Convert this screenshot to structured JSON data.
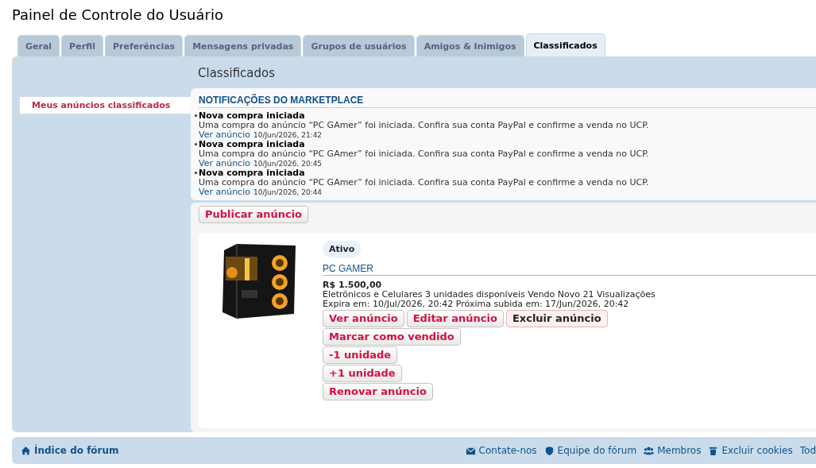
{
  "page_title": "Painel de Controle do Usuário",
  "tabs": [
    {
      "label": "Geral",
      "selected": false
    },
    {
      "label": "Perfil",
      "selected": false
    },
    {
      "label": "Preferências",
      "selected": false
    },
    {
      "label": "Mensagens privadas",
      "selected": false
    },
    {
      "label": "Grupos de usuários",
      "selected": false
    },
    {
      "label": "Amigos & Inimigos",
      "selected": false
    },
    {
      "label": "Classificados",
      "selected": true
    }
  ],
  "sidebar": {
    "items": [
      {
        "label": "Meus anúncios classificados",
        "selected": true
      }
    ]
  },
  "heading": "Classificados",
  "notifications": {
    "title": "NOTIFICAÇÕES DO MARKETPLACE",
    "items": [
      {
        "title": "Nova compra iniciada",
        "text": "Uma compra do anúncio “PC GAmer” foi iniciada. Confira sua conta PayPal e confirme a venda no UCP.",
        "link": "Ver anúncio",
        "time": "10/Jun/2026, 21:42"
      },
      {
        "title": "Nova compra iniciada",
        "text": "Uma compra do anúncio “PC GAmer” foi iniciada. Confira sua conta PayPal e confirme a venda no UCP.",
        "link": "Ver anúncio",
        "time": "10/Jun/2026, 20:45"
      },
      {
        "title": "Nova compra iniciada",
        "text": "Uma compra do anúncio “PC GAmer” foi iniciada. Confira sua conta PayPal e confirme a venda no UCP.",
        "link": "Ver anúncio",
        "time": "10/Jun/2026, 20:44"
      }
    ]
  },
  "publish_button": "Publicar anúncio",
  "listing": {
    "status": "Ativo",
    "title": "PC GAMER",
    "price": "R$ 1.500,00",
    "details": "Eletrônicos e Celulares 3 unidades disponíveis Vendo Novo 21 Visualizações",
    "dates": "Expira em: 10/Jul/2026, 20:42 Próxima subida em: 17/Jun/2026, 20:42",
    "action_rows": [
      [
        {
          "label": "Ver anúncio",
          "kind": "normal"
        },
        {
          "label": "Editar anúncio",
          "kind": "normal"
        },
        {
          "label": "Excluir anúncio",
          "kind": "danger"
        }
      ],
      [
        {
          "label": "Marcar como vendido",
          "kind": "normal"
        }
      ],
      [
        {
          "label": "-1 unidade",
          "kind": "normal"
        }
      ],
      [
        {
          "label": "+1 unidade",
          "kind": "normal"
        }
      ],
      [
        {
          "label": "Renovar anúncio",
          "kind": "normal"
        }
      ]
    ]
  },
  "footer": {
    "home": {
      "label": "Índice do fórum",
      "kind": "home"
    },
    "links": [
      {
        "label": "Contate-nos",
        "kind": "mail"
      },
      {
        "label": "Equipe do fórum",
        "kind": "shield"
      },
      {
        "label": "Membros",
        "kind": "users"
      },
      {
        "label": "Excluir cookies",
        "kind": "trash"
      },
      {
        "label": "Tod",
        "kind": "plain"
      }
    ]
  }
}
